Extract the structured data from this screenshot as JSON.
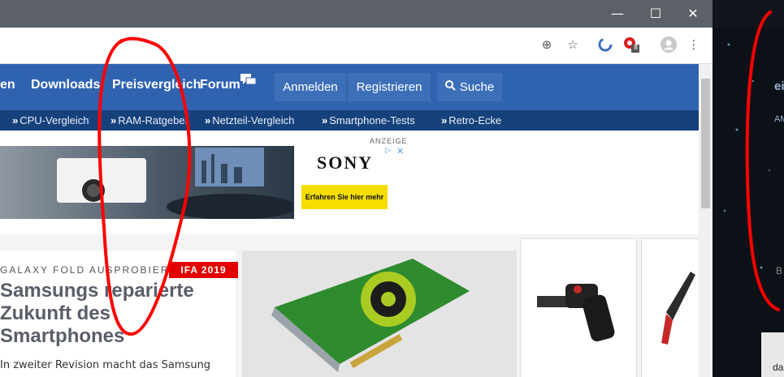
{
  "window": {
    "minimize_glyph": "—",
    "maximize_glyph": "☐",
    "close_glyph": "✕"
  },
  "toolbar": {
    "extension_badge": "8"
  },
  "nav": {
    "items": [
      "en",
      "Downloads",
      "Preisvergleich",
      "Forum"
    ],
    "login": "Anmelden",
    "register": "Registrieren",
    "search": "Suche"
  },
  "subnav": {
    "items": [
      "CPU-Vergleich",
      "RAM-Ratgeber",
      "Netzteil-Vergleich",
      "Smartphone-Tests",
      "Retro-Ecke"
    ]
  },
  "ad": {
    "label": "ANZEIGE",
    "brand": "SONY",
    "cta": "Erfahren Sie hier mehr"
  },
  "article": {
    "kicker": "GALAXY FOLD AUSPROBIERT",
    "badge": "IFA 2019",
    "headline": "Samsungs reparierte Zukunft des Smartphones",
    "teaser": "In zweiter Revision macht das Samsung"
  },
  "right_pane": {
    "text_top": "ei",
    "text_mid": "AM",
    "text_bot": "B",
    "text_last": "da"
  },
  "colors": {
    "nav": "#2f63b0",
    "subnav": "#16427c",
    "badge": "#e30000",
    "annotation": "#ff0000"
  }
}
